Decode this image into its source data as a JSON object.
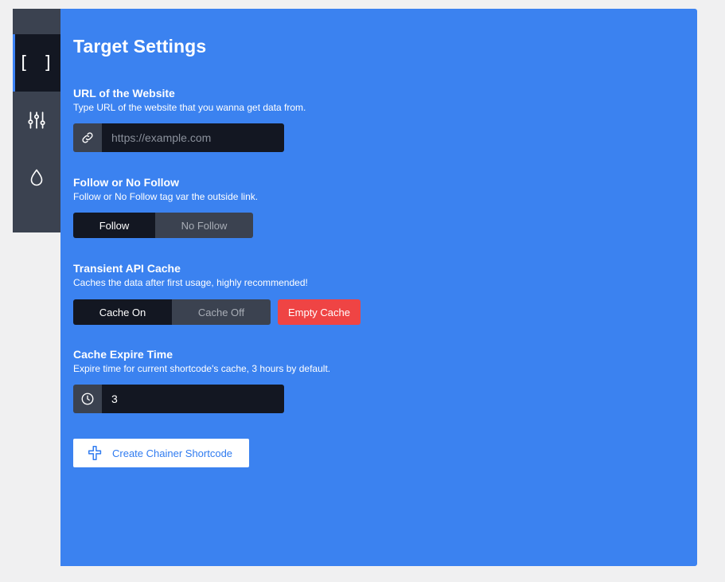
{
  "sidebar": {
    "items": [
      {
        "icon": "brackets-icon",
        "glyph": "[ ]",
        "active": true
      },
      {
        "icon": "sliders-icon",
        "active": false
      },
      {
        "icon": "drop-icon",
        "active": false
      }
    ]
  },
  "panel": {
    "title": "Target Settings",
    "url": {
      "label": "URL of the Website",
      "description": "Type URL of the website that you wanna get data from.",
      "placeholder": "https://example.com",
      "value": "",
      "icon": "link-icon"
    },
    "follow": {
      "label": "Follow or No Follow",
      "description": "Follow or No Follow tag var the outside link.",
      "options": [
        "Follow",
        "No Follow"
      ],
      "selected": "Follow"
    },
    "cache": {
      "label": "Transient API Cache",
      "description": "Caches the data after first usage, highly recommended!",
      "options": [
        "Cache On",
        "Cache Off"
      ],
      "selected": "Cache On",
      "empty_label": "Empty Cache"
    },
    "expire": {
      "label": "Cache Expire Time",
      "description": "Expire time for current shortcode's cache, 3 hours by default.",
      "value": "3",
      "icon": "clock-icon"
    },
    "create_label": "Create Chainer Shortcode"
  },
  "colors": {
    "panel": "#3b82f0",
    "dark": "#131722",
    "slate": "#3b4250",
    "danger": "#ef4444"
  }
}
